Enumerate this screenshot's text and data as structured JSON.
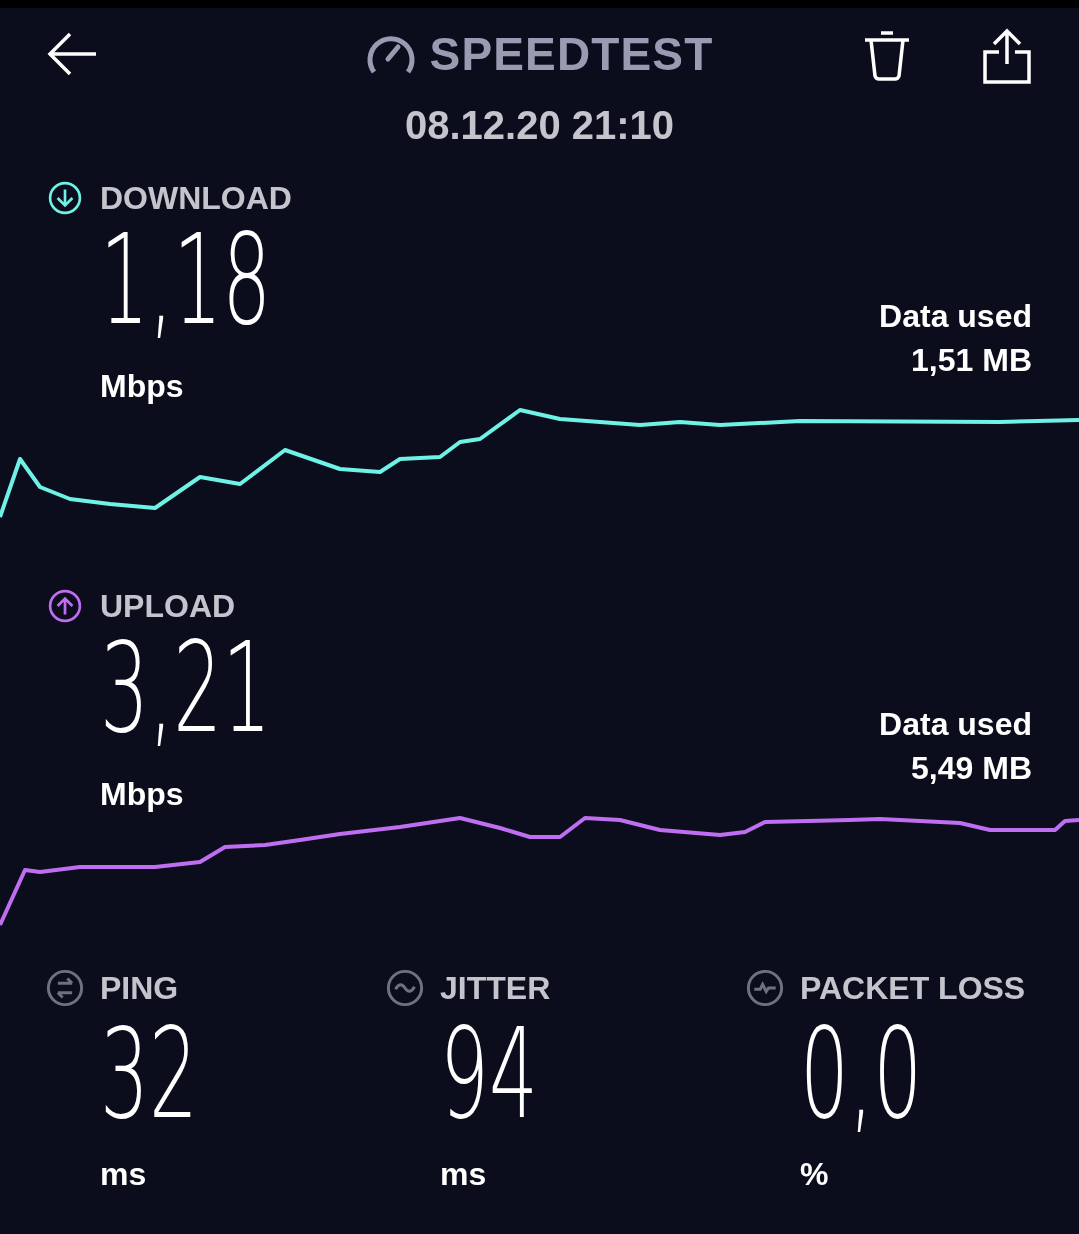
{
  "header": {
    "title": "SPEEDTEST",
    "date": "08.12.20 21:10"
  },
  "results": [
    {
      "kind": "download",
      "label": "DOWNLOAD",
      "value": "1,18",
      "unit": "Mbps",
      "data_used_label": "Data used",
      "data_used_value": "1,51 MB",
      "color": "#6ef2e6"
    },
    {
      "kind": "upload",
      "label": "UPLOAD",
      "value": "3,21",
      "unit": "Mbps",
      "data_used_label": "Data used",
      "data_used_value": "5,49 MB",
      "color": "#bf6ef2"
    }
  ],
  "metrics": [
    {
      "kind": "ping",
      "label": "PING",
      "value": "32",
      "unit": "ms"
    },
    {
      "kind": "jitter",
      "label": "JITTER",
      "value": "94",
      "unit": "ms"
    },
    {
      "kind": "packet_loss",
      "label": "PACKET LOSS",
      "value": "0,0",
      "unit": "%"
    }
  ]
}
